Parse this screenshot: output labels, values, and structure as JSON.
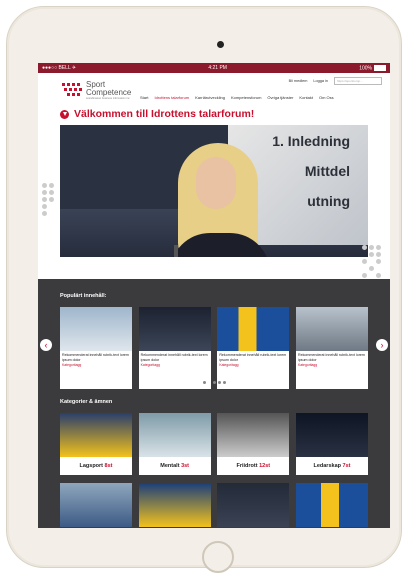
{
  "statusbar": {
    "carrier": "●●●○○ BELL ✈",
    "time": "4:21 PM",
    "battery": "100%"
  },
  "logo": {
    "line1": "Sport",
    "line2": "Competence",
    "tagline": "scandinavian business information inc"
  },
  "util": {
    "member": "Bli medlem",
    "login": "Logga in",
    "search_placeholder": "https://sportcomp..."
  },
  "nav": {
    "items": [
      "Start",
      "Idrottens talarforum",
      "Karriärutveckling",
      "Kompetensforum",
      "Övriga tjänster",
      "Kontakt",
      "Om Oss"
    ],
    "active_index": 1
  },
  "welcome": {
    "title": "Välkommen till Idrottens talarforum!"
  },
  "hero": {
    "screen_text": [
      "1. Inledning",
      "Mittdel",
      "utning"
    ]
  },
  "popular": {
    "title": "Populärt innehåll:",
    "cards": [
      {
        "text": "Rekommenderat innehåll rubrik-text lorem ipsum dolor",
        "category": "Kategoritagg"
      },
      {
        "text": "Rekommenderat innehåll rubrik-text lorem ipsum dolor",
        "category": "Kategoritagg"
      },
      {
        "text": "Rekommenderat innehåll rubrik-text lorem ipsum dolor",
        "category": "Kategoritagg"
      },
      {
        "text": "Rekommenderat innehåll rubrik-text lorem ipsum dolor",
        "category": "Kategoritagg"
      }
    ],
    "prev": "‹",
    "next": "›"
  },
  "categories": {
    "title": "Kategorier & ämnen",
    "items": [
      {
        "label": "Lagsport",
        "count": "8st"
      },
      {
        "label": "Mentalt",
        "count": "3st"
      },
      {
        "label": "Friidrott",
        "count": "12st"
      },
      {
        "label": "Ledarskap",
        "count": "7st"
      }
    ]
  },
  "colors": {
    "accent": "#c8102e",
    "statusbar": "#8a1a2c",
    "dark_section": "#3b3b3d"
  }
}
